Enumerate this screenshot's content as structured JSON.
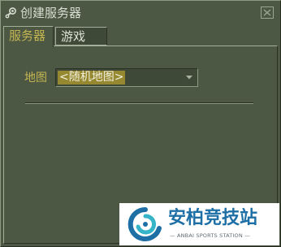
{
  "window": {
    "title": "创建服务器",
    "close_icon": "close-icon",
    "app_icon": "steam-icon"
  },
  "tabs": [
    {
      "label": "服务器",
      "active": true
    },
    {
      "label": "游戏",
      "active": false
    }
  ],
  "map": {
    "label": "地图",
    "selected": "<随机地图>",
    "arrow_icon": "chevron-down-icon"
  },
  "watermark": {
    "name": "安柏竞技站",
    "subtitle": "— ANBAI SPORTS STATION —"
  },
  "colors": {
    "background": "#4c5844",
    "accent_text": "#c4b550",
    "selection": "#958831",
    "watermark_blue": "#1e6fa5"
  }
}
